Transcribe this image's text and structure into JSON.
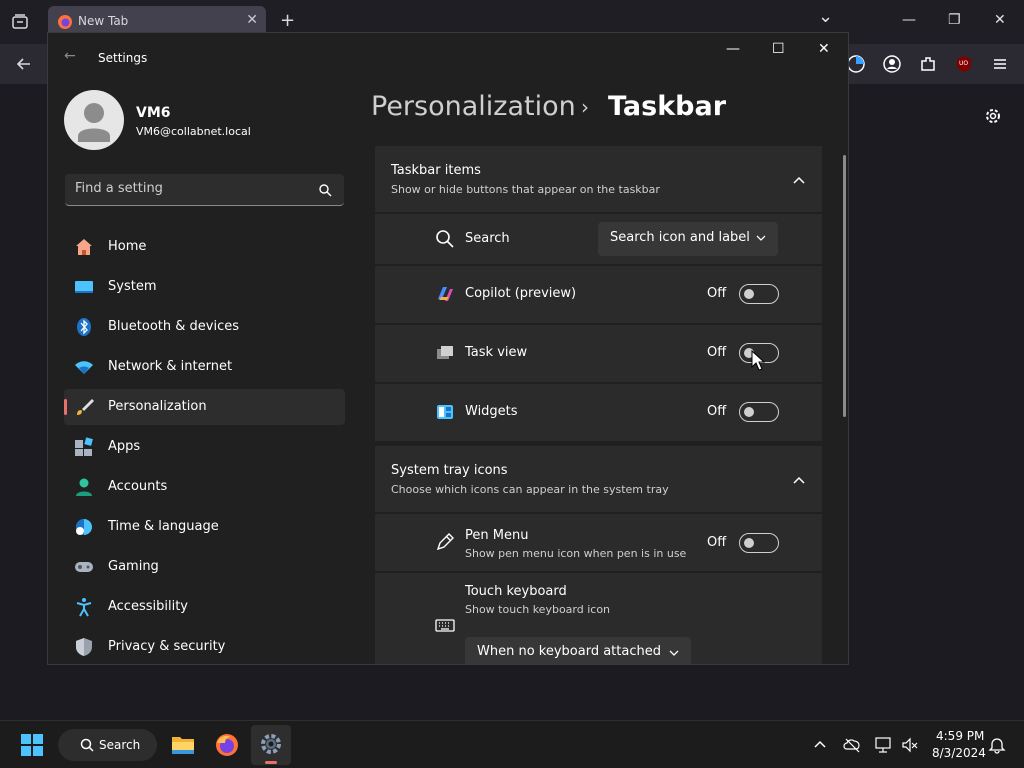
{
  "browser": {
    "tab_title": "New Tab",
    "new_tab_symbol": "+",
    "tab_close_symbol": "✕",
    "minimize_symbol": "—",
    "maximize_symbol": "❐",
    "close_symbol": "✕",
    "list_all_tabs_symbol": "⌄",
    "uo_badge": "UO",
    "icons": [
      "tabs-icon",
      "back-icon",
      "firefox-icon",
      "color-circle-icon",
      "account-icon",
      "extensions-icon",
      "ublock-icon",
      "menu-icon",
      "gear-icon"
    ]
  },
  "settings": {
    "window_title": "Settings",
    "back_symbol": "←",
    "minimize_symbol": "—",
    "maximize_symbol": "☐",
    "close_symbol": "✕",
    "user": {
      "name": "VM6",
      "email": "VM6@collabnet.local"
    },
    "search_placeholder": "Find a setting",
    "nav": [
      {
        "label": "Home",
        "icon": "home-icon"
      },
      {
        "label": "System",
        "icon": "system-icon"
      },
      {
        "label": "Bluetooth & devices",
        "icon": "bluetooth-icon"
      },
      {
        "label": "Network & internet",
        "icon": "wifi-icon"
      },
      {
        "label": "Personalization",
        "icon": "brush-icon",
        "active": true
      },
      {
        "label": "Apps",
        "icon": "apps-icon"
      },
      {
        "label": "Accounts",
        "icon": "accounts-icon"
      },
      {
        "label": "Time & language",
        "icon": "globe-clock-icon"
      },
      {
        "label": "Gaming",
        "icon": "gamepad-icon"
      },
      {
        "label": "Accessibility",
        "icon": "accessibility-icon"
      },
      {
        "label": "Privacy & security",
        "icon": "shield-icon"
      }
    ],
    "breadcrumb": {
      "parent": "Personalization",
      "separator": "›",
      "current": "Taskbar"
    },
    "taskbar_items": {
      "title": "Taskbar items",
      "subtitle": "Show or hide buttons that appear on the taskbar",
      "search": {
        "label": "Search",
        "value": "Search icon and label"
      },
      "copilot": {
        "label": "Copilot (preview)",
        "state": "Off"
      },
      "task_view": {
        "label": "Task view",
        "state": "Off"
      },
      "widgets": {
        "label": "Widgets",
        "state": "Off"
      }
    },
    "system_tray": {
      "title": "System tray icons",
      "subtitle": "Choose which icons can appear in the system tray",
      "pen_menu": {
        "label": "Pen Menu",
        "sublabel": "Show pen menu icon when pen is in use",
        "state": "Off"
      },
      "touch_keyboard": {
        "label": "Touch keyboard",
        "sublabel": "Show touch keyboard icon",
        "value": "When no keyboard attached"
      }
    }
  },
  "taskbar": {
    "search_label": "Search",
    "clock_time": "4:59 PM",
    "clock_date": "8/3/2024",
    "apps": [
      "file-explorer-icon",
      "firefox-icon",
      "settings-icon"
    ],
    "tray": [
      "chevron-up-icon",
      "onedrive-offline-icon",
      "display-network-icon",
      "volume-muted-icon",
      "notification-bell-icon"
    ]
  },
  "colors": {
    "accent": "#e8726a",
    "panel": "#202020",
    "card": "#2b2b2b",
    "taskbar": "#1c1c1c"
  }
}
